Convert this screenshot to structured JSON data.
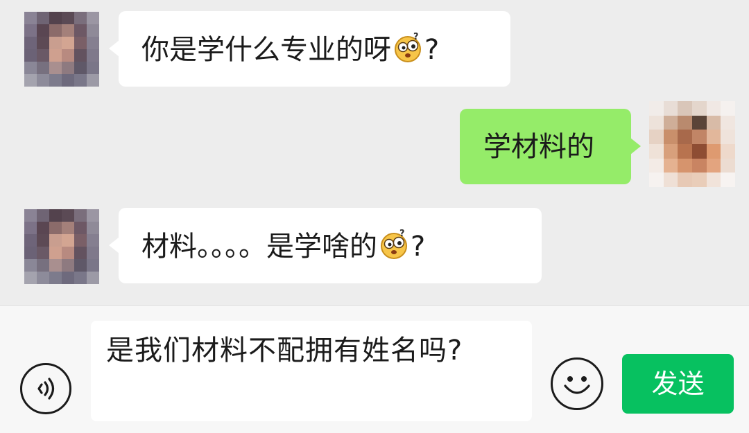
{
  "messages": [
    {
      "side": "left",
      "text_before": "你是学什么专业的呀",
      "emoji": "confused-face-emoji",
      "text_after": "?"
    },
    {
      "side": "right",
      "text": "学材料的"
    },
    {
      "side": "left",
      "text_before": "材料。。。。是学啥的",
      "emoji": "confused-face-emoji",
      "text_after": "?"
    }
  ],
  "composer": {
    "input_value": "是我们材料不配拥有姓名吗?",
    "send_label": "发送",
    "voice_icon": "voice-icon",
    "emoji_icon": "smiley-icon"
  },
  "colors": {
    "chat_background": "#ededed",
    "incoming_bubble": "#ffffff",
    "outgoing_bubble": "#95ec69",
    "send_button": "#07c160"
  }
}
